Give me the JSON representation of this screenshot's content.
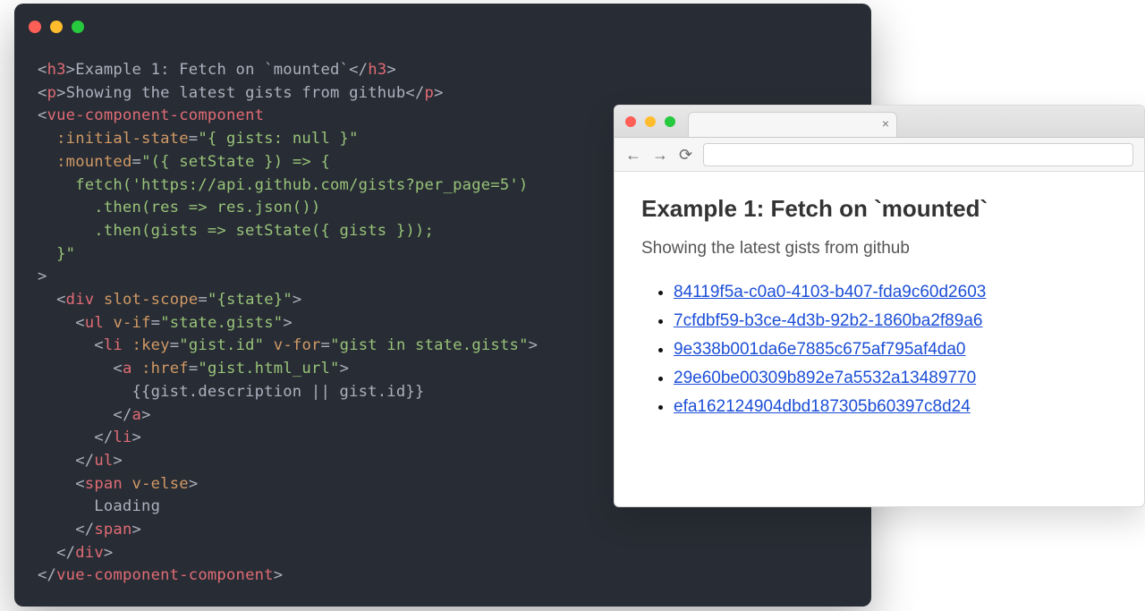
{
  "editor": {
    "tokens": [
      [
        [
          "pun",
          "<"
        ],
        [
          "tag",
          "h3"
        ],
        [
          "pun",
          ">"
        ],
        [
          "txt",
          "Example 1: Fetch on `mounted`"
        ],
        [
          "pun",
          "</"
        ],
        [
          "tag",
          "h3"
        ],
        [
          "pun",
          ">"
        ]
      ],
      [
        [
          "pun",
          "<"
        ],
        [
          "tag",
          "p"
        ],
        [
          "pun",
          ">"
        ],
        [
          "txt",
          "Showing the latest gists from github"
        ],
        [
          "pun",
          "</"
        ],
        [
          "tag",
          "p"
        ],
        [
          "pun",
          ">"
        ]
      ],
      [
        [
          "pun",
          "<"
        ],
        [
          "tag",
          "vue-component-component"
        ]
      ],
      [
        [
          "txt",
          "  "
        ],
        [
          "attr",
          ":initial-state"
        ],
        [
          "pun",
          "="
        ],
        [
          "str",
          "\"{ gists: null }\""
        ]
      ],
      [
        [
          "txt",
          "  "
        ],
        [
          "attr",
          ":mounted"
        ],
        [
          "pun",
          "="
        ],
        [
          "str",
          "\"({ setState }) => {"
        ]
      ],
      [
        [
          "str",
          "    fetch('https://api.github.com/gists?per_page=5')"
        ]
      ],
      [
        [
          "str",
          "      .then(res => res.json())"
        ]
      ],
      [
        [
          "str",
          "      .then(gists => setState({ gists }));"
        ]
      ],
      [
        [
          "str",
          "  }\""
        ]
      ],
      [
        [
          "pun",
          ">"
        ]
      ],
      [
        [
          "txt",
          "  "
        ],
        [
          "pun",
          "<"
        ],
        [
          "tag",
          "div"
        ],
        [
          "txt",
          " "
        ],
        [
          "attr",
          "slot-scope"
        ],
        [
          "pun",
          "="
        ],
        [
          "str",
          "\"{state}\""
        ],
        [
          "pun",
          ">"
        ]
      ],
      [
        [
          "txt",
          "    "
        ],
        [
          "pun",
          "<"
        ],
        [
          "tag",
          "ul"
        ],
        [
          "txt",
          " "
        ],
        [
          "attr",
          "v-if"
        ],
        [
          "pun",
          "="
        ],
        [
          "str",
          "\"state.gists\""
        ],
        [
          "pun",
          ">"
        ]
      ],
      [
        [
          "txt",
          "      "
        ],
        [
          "pun",
          "<"
        ],
        [
          "tag",
          "li"
        ],
        [
          "txt",
          " "
        ],
        [
          "attr",
          ":key"
        ],
        [
          "pun",
          "="
        ],
        [
          "str",
          "\"gist.id\""
        ],
        [
          "txt",
          " "
        ],
        [
          "attr",
          "v-for"
        ],
        [
          "pun",
          "="
        ],
        [
          "str",
          "\"gist in state.gists\""
        ],
        [
          "pun",
          ">"
        ]
      ],
      [
        [
          "txt",
          "        "
        ],
        [
          "pun",
          "<"
        ],
        [
          "tag",
          "a"
        ],
        [
          "txt",
          " "
        ],
        [
          "attr",
          ":href"
        ],
        [
          "pun",
          "="
        ],
        [
          "str",
          "\"gist.html_url\""
        ],
        [
          "pun",
          ">"
        ]
      ],
      [
        [
          "txt",
          "          "
        ],
        [
          "mus",
          "{{gist.description || gist.id}}"
        ]
      ],
      [
        [
          "txt",
          "        "
        ],
        [
          "pun",
          "</"
        ],
        [
          "tag",
          "a"
        ],
        [
          "pun",
          ">"
        ]
      ],
      [
        [
          "txt",
          "      "
        ],
        [
          "pun",
          "</"
        ],
        [
          "tag",
          "li"
        ],
        [
          "pun",
          ">"
        ]
      ],
      [
        [
          "txt",
          "    "
        ],
        [
          "pun",
          "</"
        ],
        [
          "tag",
          "ul"
        ],
        [
          "pun",
          ">"
        ]
      ],
      [
        [
          "txt",
          "    "
        ],
        [
          "pun",
          "<"
        ],
        [
          "tag",
          "span"
        ],
        [
          "txt",
          " "
        ],
        [
          "attr",
          "v-else"
        ],
        [
          "pun",
          ">"
        ]
      ],
      [
        [
          "txt",
          "      Loading"
        ]
      ],
      [
        [
          "txt",
          "    "
        ],
        [
          "pun",
          "</"
        ],
        [
          "tag",
          "span"
        ],
        [
          "pun",
          ">"
        ]
      ],
      [
        [
          "txt",
          "  "
        ],
        [
          "pun",
          "</"
        ],
        [
          "tag",
          "div"
        ],
        [
          "pun",
          ">"
        ]
      ],
      [
        [
          "pun",
          "</"
        ],
        [
          "tag",
          "vue-component-component"
        ],
        [
          "pun",
          ">"
        ]
      ]
    ]
  },
  "browser": {
    "tab_close": "×",
    "nav_back": "←",
    "nav_fwd": "→",
    "reload": "⟳",
    "heading": "Example 1: Fetch on `mounted`",
    "subtitle": "Showing the latest gists from github",
    "gists": [
      "84119f5a-c0a0-4103-b407-fda9c60d2603",
      "7cfdbf59-b3ce-4d3b-92b2-1860ba2f89a6",
      "9e338b001da6e7885c675af795af4da0",
      "29e60be00309b892e7a5532a13489770",
      "efa162124904dbd187305b60397c8d24"
    ]
  }
}
